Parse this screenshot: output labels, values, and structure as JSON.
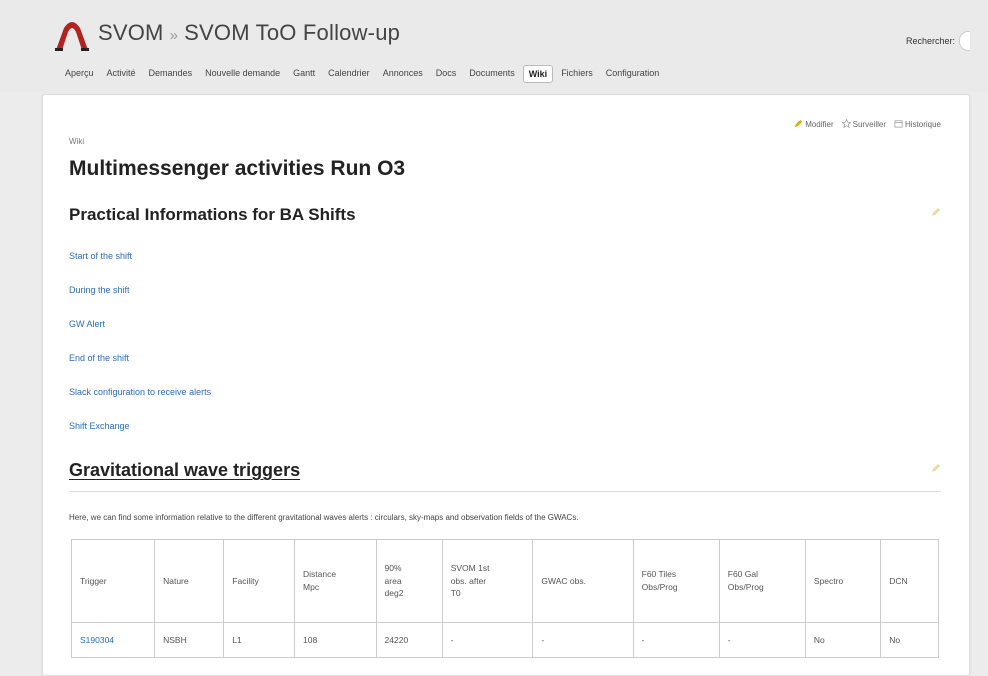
{
  "header": {
    "project": "SVOM",
    "separator": "»",
    "subproject": "SVOM ToO Follow-up",
    "search_label": "Rechercher:",
    "logo_color": "#b22222"
  },
  "menu": [
    {
      "label": "Aperçu",
      "selected": false
    },
    {
      "label": "Activité",
      "selected": false
    },
    {
      "label": "Demandes",
      "selected": false
    },
    {
      "label": "Nouvelle demande",
      "selected": false
    },
    {
      "label": "Gantt",
      "selected": false
    },
    {
      "label": "Calendrier",
      "selected": false
    },
    {
      "label": "Annonces",
      "selected": false
    },
    {
      "label": "Docs",
      "selected": false
    },
    {
      "label": "Documents",
      "selected": false
    },
    {
      "label": "Wiki",
      "selected": true
    },
    {
      "label": "Fichiers",
      "selected": false
    },
    {
      "label": "Configuration",
      "selected": false
    }
  ],
  "contextual": {
    "edit": "Modifier",
    "watch": "Surveiller",
    "history": "Historique"
  },
  "breadcrumb": "Wiki",
  "page_title": "Multimessenger activities Run O3",
  "section1": {
    "title": "Practical Informations for BA Shifts",
    "links": [
      "Start of the shift",
      "During the shift",
      "GW Alert",
      "End of the shift",
      "Slack configuration to receive alerts",
      "Shift Exchange"
    ]
  },
  "section2": {
    "title": "Gravitational wave triggers",
    "intro": "Here, we can find some information relative to the different gravitational waves alerts : circulars, sky-maps and observation fields of the GWACs.",
    "table": {
      "headers": [
        "Trigger",
        "Nature",
        "Facility",
        "Distance\nMpc",
        "90%\narea\ndeg2",
        "SVOM 1st\nobs. after\nT0",
        "GWAC obs.",
        "F60 Tiles\nObs/Prog",
        "F60 Gal\nObs/Prog",
        "Spectro",
        "DCN"
      ],
      "rows": [
        [
          "S190304",
          "NSBH",
          "L1",
          "108",
          "24220",
          "-",
          "-",
          "-",
          "-",
          "No",
          "No"
        ]
      ]
    }
  },
  "colors": {
    "link": "#2a6ebb",
    "background": "#ececec",
    "panel": "#ffffff"
  }
}
